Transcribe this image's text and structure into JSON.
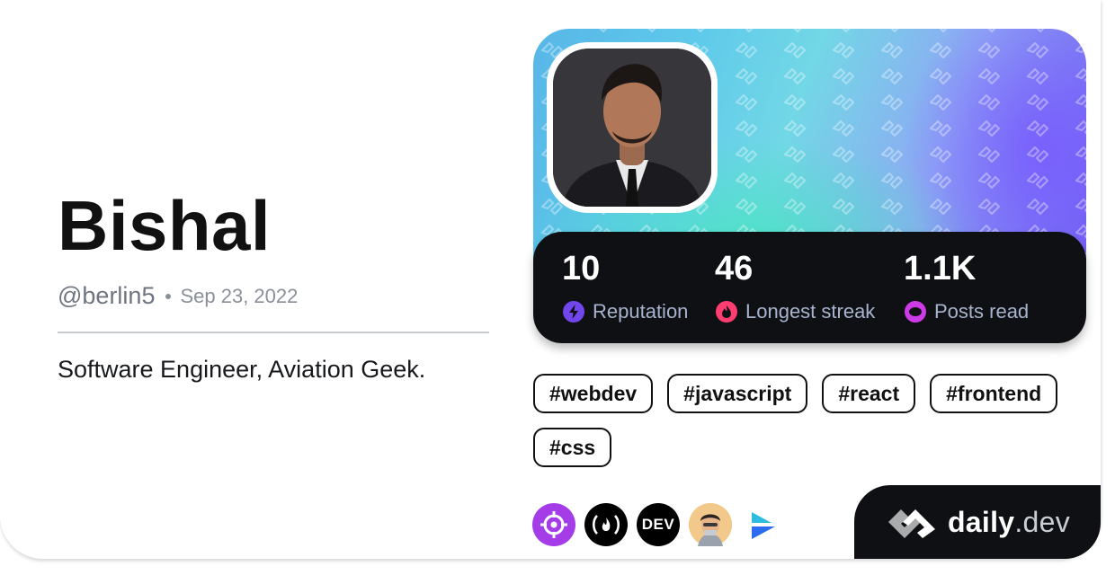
{
  "profile": {
    "name": "Bishal",
    "handle": "@berlin5",
    "joined": "Sep 23, 2022",
    "bio": "Software Engineer, Aviation Geek."
  },
  "stats": [
    {
      "value": "10",
      "label": "Reputation",
      "icon": "bolt-icon",
      "color": "#7147ed"
    },
    {
      "value": "46",
      "label": "Longest streak",
      "icon": "flame-icon",
      "color": "#ff3d71"
    },
    {
      "value": "1.1K",
      "label": "Posts read",
      "icon": "ring-icon",
      "color": "#cf3ae8"
    }
  ],
  "tags": [
    "#webdev",
    "#javascript",
    "#react",
    "#frontend",
    "#css"
  ],
  "badges": [
    {
      "icon": "crosshair-icon",
      "color": "#a43de8"
    },
    {
      "icon": "freecodecamp-icon",
      "color": "#0a0a23"
    },
    {
      "icon": "dev-icon",
      "color": "#000000",
      "text": "DEV"
    },
    {
      "icon": "avatar-icon",
      "color": "#f2b86f"
    },
    {
      "icon": "arrow-logo-icon",
      "color": "#2c8bf0"
    }
  ],
  "brand": {
    "name_main": "daily",
    "name_suffix": ".dev",
    "icon": "daily-dev-logo-icon"
  },
  "colors": {
    "card_bg": "#ffffff",
    "dark": "#0e1013",
    "muted": "#a8b3cf"
  }
}
